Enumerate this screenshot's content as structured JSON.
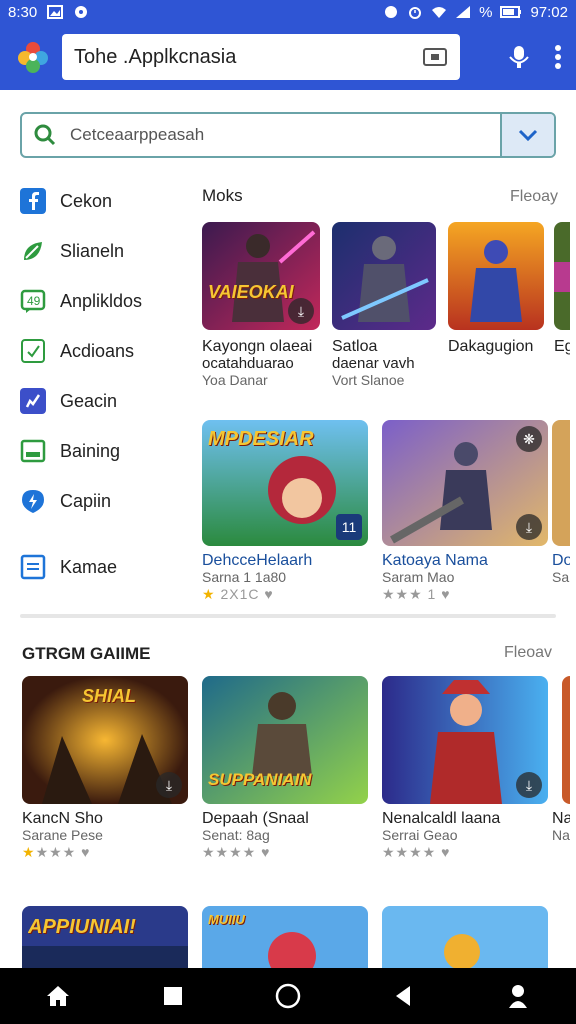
{
  "status": {
    "time": "8:30",
    "clock": "97:02",
    "signal_text": "%"
  },
  "app_bar": {
    "title": "Tohe .Applkcnasia"
  },
  "search": {
    "placeholder": "Cetceaarppeasah"
  },
  "sidebar": {
    "items": [
      {
        "label": "Cekon",
        "icon": "facebook-icon",
        "color": "#1e74d8"
      },
      {
        "label": "Slianeln",
        "icon": "leaf-icon",
        "color": "#2e9b3f"
      },
      {
        "label": "Anplikldos",
        "icon": "chat-icon",
        "color": "#2e9b3f"
      },
      {
        "label": "Acdioans",
        "icon": "check-icon",
        "color": "#2e9b3f"
      },
      {
        "label": "Geacin",
        "icon": "pen-icon",
        "color": "#3c4fc9"
      },
      {
        "label": "Baining",
        "icon": "calendar-icon",
        "color": "#2e9b3f"
      },
      {
        "label": "Capiin",
        "icon": "location-icon",
        "color": "#1e74d8"
      },
      {
        "label": "Kamae",
        "icon": "document-icon",
        "color": "#1e74d8"
      }
    ]
  },
  "section1": {
    "title": "Moks",
    "more": "Fleoay",
    "apps": [
      {
        "banner": "VAIEOKAI",
        "name": "Kayongn olaeai",
        "sub": "ocatahduarao",
        "sub2": "Yoa Danar"
      },
      {
        "banner": "",
        "name": "Satloa",
        "sub": "daenar vavh",
        "sub2": "Vort Slanoe"
      },
      {
        "banner": "",
        "name": "Dakagugion",
        "sub": "",
        "sub2": ""
      },
      {
        "banner": "",
        "name": "Eg",
        "sub": "",
        "sub2": ""
      }
    ],
    "featured": [
      {
        "banner": "MPDESIAR",
        "name": "DehcceHelaarh",
        "sub": "Sarna 1 1a80",
        "rating_text": "2X1C",
        "gold_stars": 1,
        "badge": "11"
      },
      {
        "banner": "",
        "name": "Katoaya Nama",
        "sub": "Saram Mao",
        "rating_text": "1",
        "gold_stars": 0,
        "badge": ""
      },
      {
        "banner": "",
        "name": "Do",
        "sub": "Sa",
        "rating_text": "",
        "gold_stars": 0,
        "badge": ""
      }
    ]
  },
  "section2": {
    "title": "GTRGM GAIIME",
    "more": "Fleoav",
    "apps": [
      {
        "banner": "SHIAL",
        "name": "KancN Sho",
        "sub": "Sarane Pese",
        "gold_stars": 1
      },
      {
        "banner": "SUPPANIAIN",
        "name": "Depaah (Snaal",
        "sub": "Senat: 8ag",
        "gold_stars": 0
      },
      {
        "banner": "",
        "name": "Nenalcaldl laana",
        "sub": "Serrai Geao",
        "gold_stars": 0
      },
      {
        "banner": "",
        "name": "Na",
        "sub": "Na",
        "gold_stars": 0
      }
    ]
  },
  "section3": {
    "apps": [
      {
        "banner": "APPIUNIAI!"
      },
      {
        "banner": "MUIIU"
      },
      {
        "banner": ""
      }
    ]
  },
  "colors": {
    "primary": "#2f55d4",
    "accent_border": "#6aa3a8",
    "star": "#f2b300"
  }
}
